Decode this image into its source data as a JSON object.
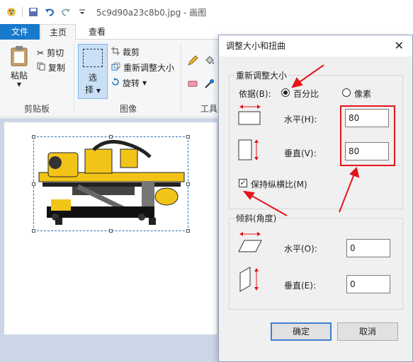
{
  "window": {
    "title": "5c9d90a23c8b0.jpg - 画图"
  },
  "ribbon_tabs": {
    "file": "文件",
    "home": "主页",
    "view": "查看"
  },
  "clipboard": {
    "paste": "粘贴",
    "cut": "剪切",
    "copy": "复制",
    "group": "剪贴板"
  },
  "image": {
    "select_1": "选",
    "select_2": "择",
    "crop": "裁剪",
    "resize": "重新调整大小",
    "rotate": "旋转",
    "group": "图像"
  },
  "tools": {
    "group": "工具"
  },
  "dialog": {
    "title": "调整大小和扭曲",
    "resize_group": "重新调整大小",
    "by_label": "依据(B):",
    "percent": "百分比",
    "pixels": "像素",
    "horizontal_label": "水平(H):",
    "horizontal_value": "80",
    "vertical_label": "垂直(V):",
    "vertical_value": "80",
    "keep_ratio": "保持纵横比(M)",
    "skew_group": "倾斜(角度)",
    "skew_h_label": "水平(O):",
    "skew_h_value": "0",
    "skew_v_label": "垂直(E):",
    "skew_v_value": "0",
    "ok": "确定",
    "cancel": "取消"
  },
  "colors": {
    "accent": "#1979ca",
    "annotation": "#e4141b"
  }
}
